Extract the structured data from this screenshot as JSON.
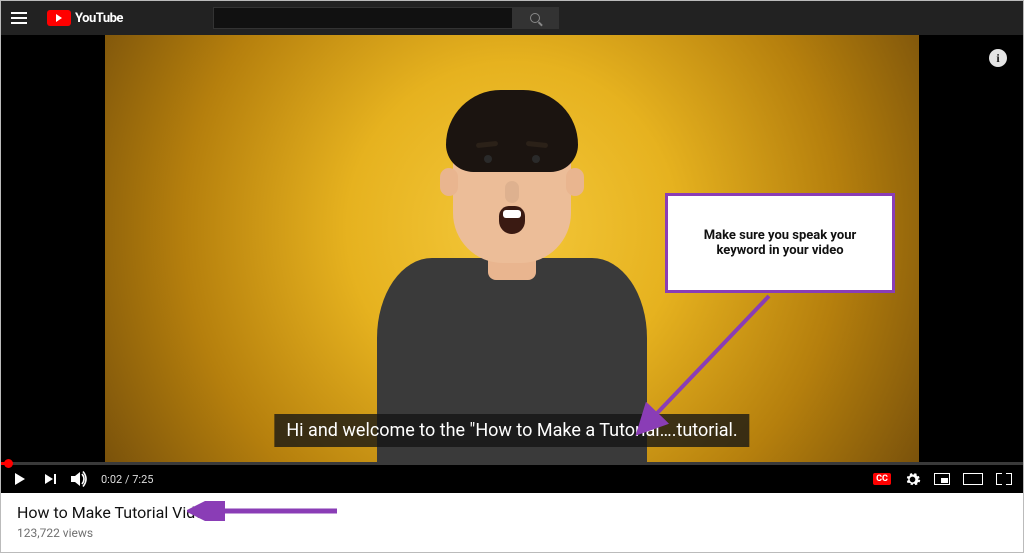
{
  "header": {
    "brand": "YouTube",
    "search": {
      "value": "",
      "placeholder": ""
    }
  },
  "player": {
    "caption_text": "Hi and welcome to the \"How to Make a Tutorial….tutorial.",
    "time_current": "0:02",
    "time_total": "7:25",
    "cc_label": "CC",
    "info_glyph": "i"
  },
  "annotation": {
    "callout_text": "Make sure you speak your keyword in your video"
  },
  "meta": {
    "title": "How to Make Tutorial Videos",
    "views": "123,722 views"
  },
  "colors": {
    "accent_red": "#ff0000",
    "annotation_purple": "#8a3db6"
  }
}
